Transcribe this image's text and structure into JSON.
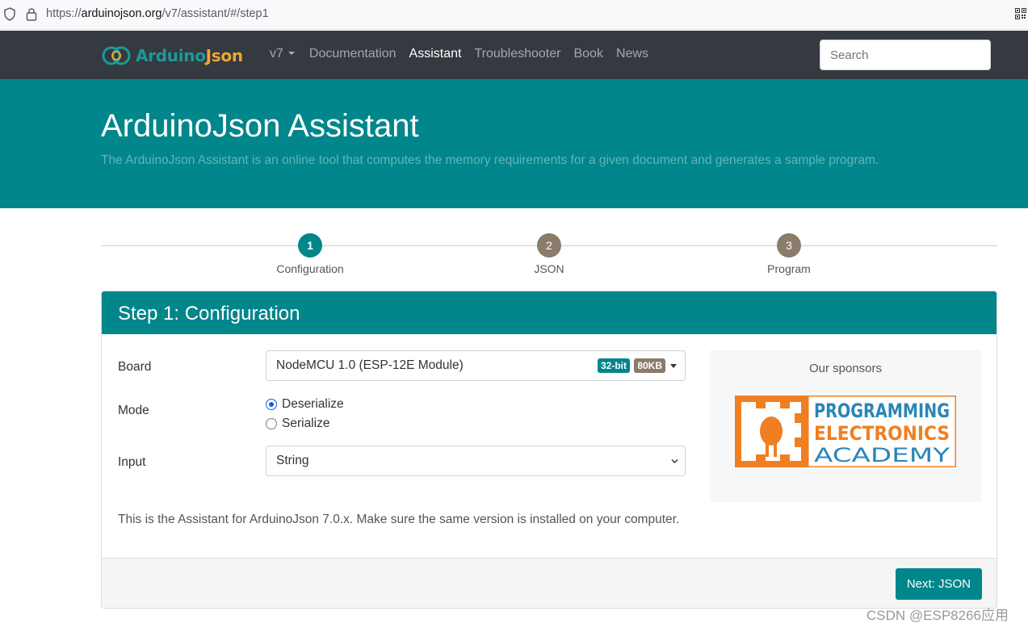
{
  "browser": {
    "url_prefix": "https://",
    "url_host": "arduinojson.org",
    "url_path": "/v7/assistant/#/step1"
  },
  "navbar": {
    "brand_part1": "Arduino",
    "brand_part2": "Json",
    "version": "v7",
    "links": [
      "Documentation",
      "Assistant",
      "Troubleshooter",
      "Book",
      "News"
    ],
    "active_link": "Assistant",
    "search_placeholder": "Search"
  },
  "hero": {
    "title": "ArduinoJson Assistant",
    "subtitle": "The ArduinoJson Assistant is an online tool that computes the memory requirements for a given document and generates a sample program."
  },
  "stepper": {
    "steps": [
      {
        "number": "1",
        "label": "Configuration",
        "active": true
      },
      {
        "number": "2",
        "label": "JSON",
        "active": false
      },
      {
        "number": "3",
        "label": "Program",
        "active": false
      }
    ]
  },
  "card": {
    "title": "Step 1: Configuration",
    "board_label": "Board",
    "board_value": "NodeMCU 1.0 (ESP-12E Module)",
    "board_badge_bits": "32-bit",
    "board_badge_memory": "80KB",
    "mode_label": "Mode",
    "mode_options": [
      "Deserialize",
      "Serialize"
    ],
    "mode_selected": "Deserialize",
    "input_label": "Input",
    "input_value": "String",
    "note": "This is the Assistant for ArduinoJson 7.0.x. Make sure the same version is installed on your computer.",
    "sponsor_title": "Our sponsors",
    "sponsor_logo_lines": [
      "PROGRAMMING",
      "ELECTRONICS",
      "ACADEMY"
    ],
    "next_button": "Next: JSON"
  },
  "watermark": "CSDN @ESP8266应用",
  "colors": {
    "teal": "#00868b",
    "navbar": "#343a40",
    "step_inactive": "#8b7b6b",
    "sponsor_orange": "#f07f22",
    "sponsor_blue": "#2a86b8"
  }
}
